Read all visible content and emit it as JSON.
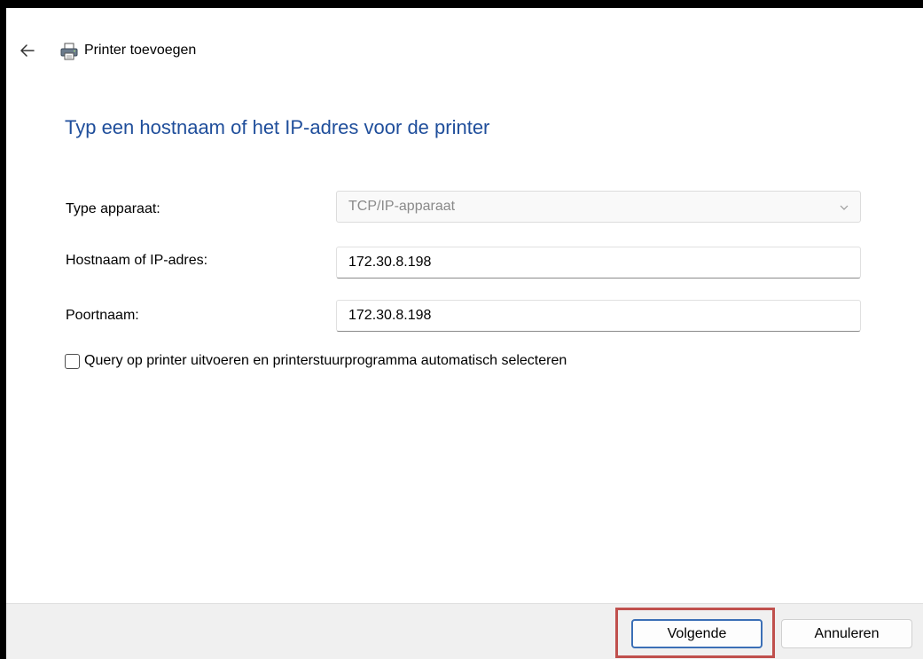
{
  "window": {
    "title": "Printer toevoegen"
  },
  "main": {
    "heading": "Typ een hostnaam of het IP-adres voor de printer"
  },
  "form": {
    "device_type_label": "Type apparaat:",
    "device_type_value": "TCP/IP-apparaat",
    "hostname_label": "Hostnaam of IP-adres:",
    "hostname_value": "172.30.8.198",
    "port_label": "Poortnaam:",
    "port_value": "172.30.8.198",
    "query_checkbox_label": "Query op printer uitvoeren en printerstuurprogramma automatisch selecteren",
    "query_checkbox_checked": false
  },
  "footer": {
    "next_label": "Volgende",
    "cancel_label": "Annuleren"
  },
  "icons": {
    "back": "back-arrow-icon",
    "printer": "printer-icon",
    "dropdown": "chevron-down-icon"
  },
  "colors": {
    "heading": "#1f4e9b",
    "primary_button_border": "#3b6fb6",
    "highlight": "#c0504d",
    "footer_bg": "#f0f0f0"
  }
}
